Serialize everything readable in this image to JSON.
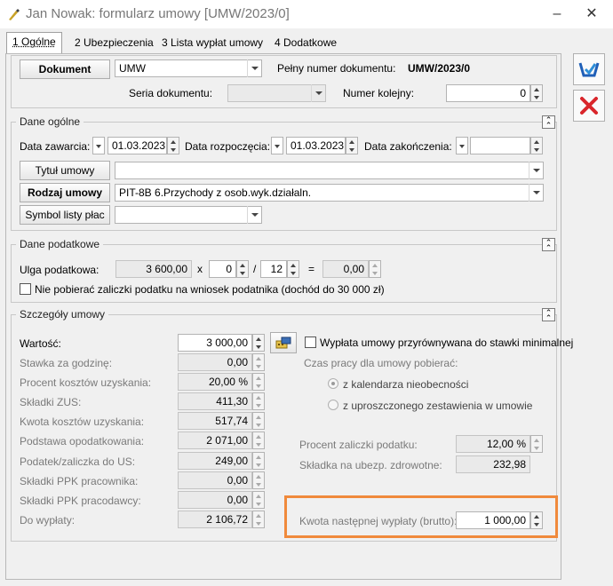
{
  "window": {
    "title": "Jan Nowak: formularz umowy [UMW/2023/0]"
  },
  "tabs": [
    {
      "label": "1 Ogólne"
    },
    {
      "label": "2 Ubezpieczenia"
    },
    {
      "label": "3 Lista wypłat umowy"
    },
    {
      "label": "4 Dodatkowe"
    }
  ],
  "document": {
    "button": "Dokument",
    "type_value": "UMW",
    "full_number_label": "Pełny numer dokumentu:",
    "full_number_value": "UMW/2023/0",
    "series_label": "Seria dokumentu:",
    "series_value": "",
    "seq_label": "Numer kolejny:",
    "seq_value": "0"
  },
  "general": {
    "title": "Dane ogólne",
    "date_signed_label": "Data zawarcia:",
    "date_signed_value": "01.03.2023",
    "date_start_label": "Data rozpoczęcia:",
    "date_start_value": "01.03.2023",
    "date_end_label": "Data zakończenia:",
    "date_end_value": "",
    "contract_title_button": "Tytuł umowy",
    "contract_title_value": "",
    "contract_type_button": "Rodzaj umowy",
    "contract_type_value": "PIT-8B  6.Przychody z osob.wyk.działaln.",
    "payroll_symbol_button": "Symbol listy płac",
    "payroll_symbol_value": ""
  },
  "tax": {
    "title": "Dane podatkowe",
    "relief_label": "Ulga podatkowa:",
    "relief_value": "3 600,00",
    "times": "x",
    "numerator": "0",
    "slash": "/",
    "denominator": "12",
    "equals": "=",
    "result": "0,00",
    "no_advance_label": "Nie pobierać zaliczki podatku na wniosek podatnika (dochód do 30 000 zł)"
  },
  "details": {
    "title": "Szczegóły umowy",
    "rows": [
      {
        "label": "Wartość:",
        "value": "3 000,00"
      },
      {
        "label": "Stawka za godzinę:",
        "value": "0,00"
      },
      {
        "label": "Procent kosztów uzyskania:",
        "value": "20,00 %"
      },
      {
        "label": "Składki ZUS:",
        "value": "411,30"
      },
      {
        "label": "Kwota kosztów uzyskania:",
        "value": "517,74"
      },
      {
        "label": "Podstawa opodatkowania:",
        "value": "2 071,00"
      },
      {
        "label": "Podatek/zaliczka do US:",
        "value": "249,00"
      },
      {
        "label": "Składki PPK pracownika:",
        "value": "0,00"
      },
      {
        "label": "Składki PPK pracodawcy:",
        "value": "0,00"
      },
      {
        "label": "Do wypłaty:",
        "value": "2 106,72"
      }
    ],
    "min_rate_label": "Wypłata umowy przyrównywana do stawki minimalnej",
    "work_time_label": "Czas pracy dla umowy pobierać:",
    "radio_calendar": "z kalendarza nieobecności",
    "radio_simplified": "z uproszczonego zestawienia w umowie",
    "tax_percent_label": "Procent zaliczki podatku:",
    "tax_percent_value": "12,00 %",
    "health_label": "Składka na ubezp. zdrowotne:",
    "health_value": "232,98",
    "next_payment_label": "Kwota następnej wypłaty (brutto):",
    "next_payment_value": "1 000,00"
  },
  "colors": {
    "highlight": "#f08a3c",
    "cancel_red": "#d9262b",
    "save_blue": "#1f5fb8"
  }
}
